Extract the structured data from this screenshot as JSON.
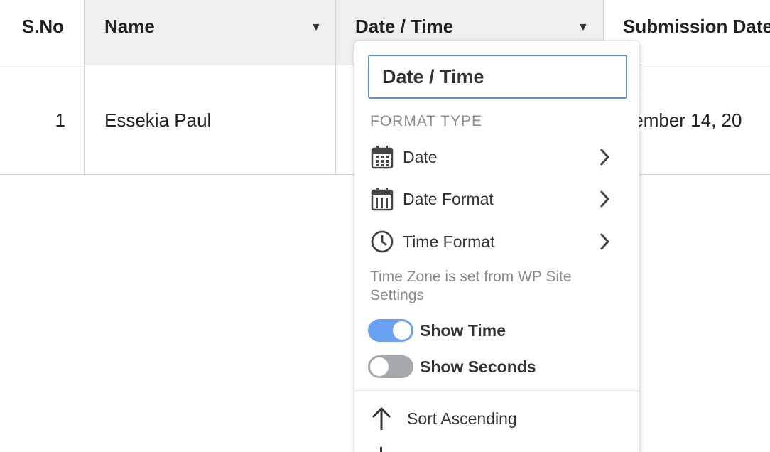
{
  "table": {
    "headers": {
      "sno": "S.No",
      "name": "Name",
      "date_time": "Date / Time",
      "submission_date": "Submission Date"
    },
    "rows": [
      {
        "sno": "1",
        "name": "Essekia Paul",
        "submission_date": "December 14, 20"
      }
    ]
  },
  "menu": {
    "title_value": "Date / Time",
    "section_label": "FORMAT TYPE",
    "items": [
      {
        "label": "Date",
        "icon": "calendar-icon"
      },
      {
        "label": "Date Format",
        "icon": "calendar-columns-icon"
      },
      {
        "label": "Time Format",
        "icon": "clock-icon"
      }
    ],
    "timezone_note": "Time Zone is set from WP Site Settings",
    "toggles": [
      {
        "label": "Show Time",
        "on": true
      },
      {
        "label": "Show Seconds",
        "on": false
      }
    ],
    "sort_ascending": "Sort Ascending",
    "colors": {
      "accent": "#6ba1f2",
      "input_border": "#5b8fd6",
      "toggle_off": "#a5a8ad"
    }
  }
}
